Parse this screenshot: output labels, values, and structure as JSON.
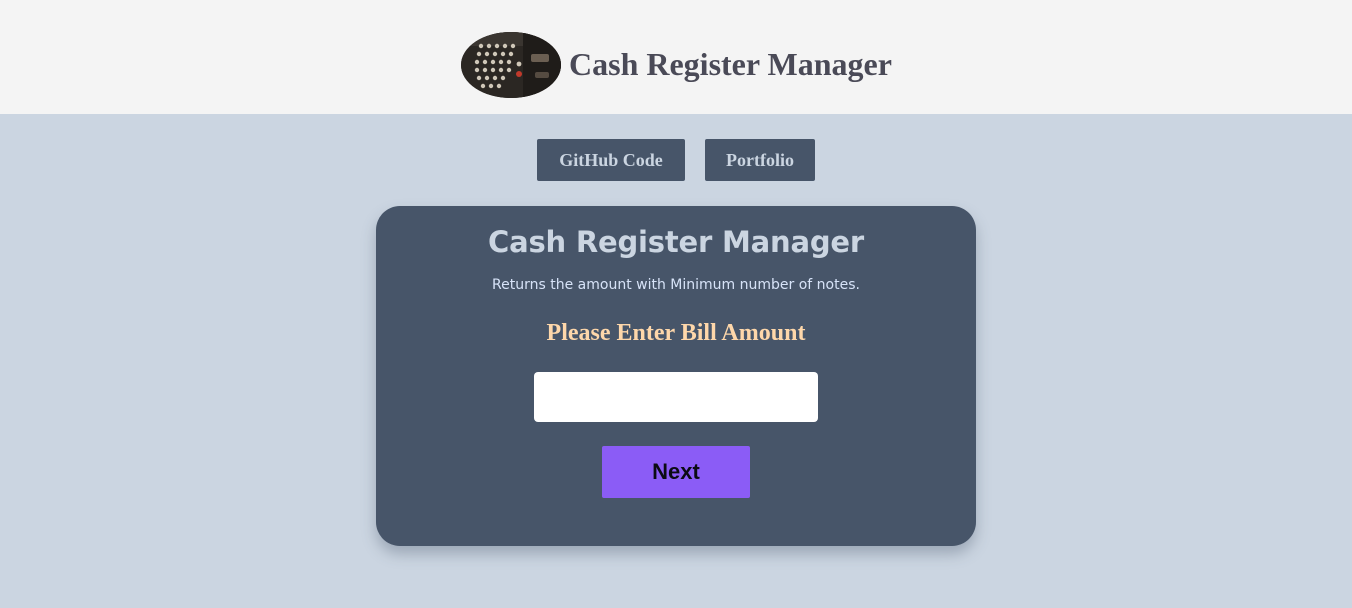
{
  "header": {
    "logo_icon": "cash-register-photo-icon",
    "title": "Cash Register Manager"
  },
  "nav": {
    "github_label": "GitHub Code",
    "portfolio_label": "Portfolio"
  },
  "card": {
    "title": "Cash Register Manager",
    "subtitle": "Returns the amount with Minimum number of notes.",
    "bill_label": "Please Enter Bill Amount",
    "bill_input_value": "",
    "next_label": "Next"
  },
  "colors": {
    "page_background": "#cbd5e1",
    "header_background": "#f4f4f4",
    "card_background": "#475569",
    "label_accent": "#fed7aa",
    "button_accent": "#8b5cf6"
  }
}
